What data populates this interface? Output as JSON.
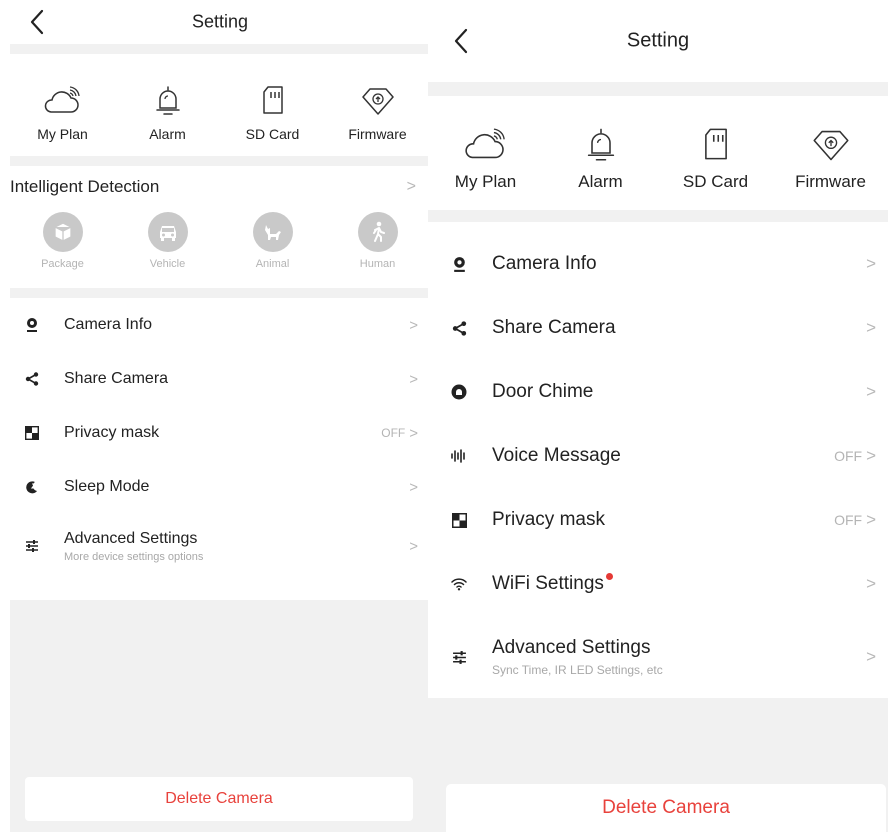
{
  "left": {
    "title": "Setting",
    "plans": [
      {
        "label": "My Plan",
        "icon": "cloud-icon"
      },
      {
        "label": "Alarm",
        "icon": "bell-icon"
      },
      {
        "label": "SD Card",
        "icon": "sd-card-icon"
      },
      {
        "label": "Firmware",
        "icon": "firmware-icon"
      }
    ],
    "detection": {
      "title": "Intelligent Detection",
      "items": [
        {
          "label": "Package",
          "icon": "package-icon"
        },
        {
          "label": "Vehicle",
          "icon": "vehicle-icon"
        },
        {
          "label": "Animal",
          "icon": "animal-icon"
        },
        {
          "label": "Human",
          "icon": "human-icon"
        }
      ]
    },
    "menu": [
      {
        "label": "Camera Info",
        "icon": "camera-icon"
      },
      {
        "label": "Share Camera",
        "icon": "share-icon"
      },
      {
        "label": "Privacy mask",
        "icon": "privacy-mask-icon",
        "value": "OFF"
      },
      {
        "label": "Sleep Mode",
        "icon": "sleep-icon"
      },
      {
        "label": "Advanced  Settings",
        "icon": "sliders-icon",
        "sub": "More device settings options"
      }
    ],
    "delete_label": "Delete Camera"
  },
  "right": {
    "title": "Setting",
    "plans": [
      {
        "label": "My Plan",
        "icon": "cloud-icon"
      },
      {
        "label": "Alarm",
        "icon": "bell-icon"
      },
      {
        "label": "SD Card",
        "icon": "sd-card-icon"
      },
      {
        "label": "Firmware",
        "icon": "firmware-icon"
      }
    ],
    "menu": [
      {
        "label": "Camera Info",
        "icon": "camera-icon"
      },
      {
        "label": "Share Camera",
        "icon": "share-icon"
      },
      {
        "label": "Door Chime",
        "icon": "chime-icon"
      },
      {
        "label": "Voice Message",
        "icon": "voice-icon",
        "value": "OFF"
      },
      {
        "label": "Privacy mask",
        "icon": "privacy-mask-icon",
        "value": "OFF"
      },
      {
        "label": "WiFi Settings",
        "icon": "wifi-icon",
        "badge": "red-dot"
      },
      {
        "label": "Advanced  Settings",
        "icon": "sliders-icon",
        "sub": "Sync Time, IR LED Settings, etc"
      }
    ],
    "delete_label": "Delete Camera"
  },
  "colors": {
    "delete": "#e8423c",
    "separator": "#f1f1f1",
    "chevron": "#b8b8b8",
    "detect_icon": "#c9c9c9",
    "badge": "#e53935"
  },
  "chevron": ">"
}
